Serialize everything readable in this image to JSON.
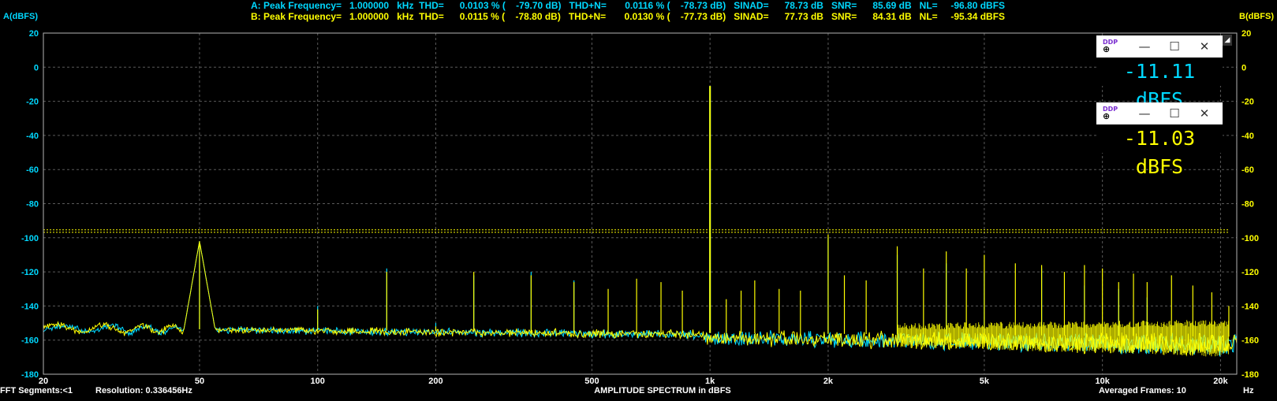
{
  "colors": {
    "channel_a": "#00d8ff",
    "channel_b": "#ffff00",
    "grid": "#5a5a5a",
    "frame": "#b4b4b4",
    "threshold": "#ffff00",
    "text": "#ffffff",
    "background": "#000000"
  },
  "measurements": {
    "a": "A: Peak Frequency=   1.000000   kHz  THD=      0.0103 % (    -79.70 dB)   THD+N=       0.0116 % (    -78.73 dB)   SINAD=      78.73 dB   SNR=      85.69 dB   NL=     -96.80 dBFS",
    "b": "B: Peak Frequency=   1.000000   kHz  THD=      0.0115 % (    -78.80 dB)   THD+N=       0.0130 % (    -77.73 dB)   SINAD=      77.73 dB   SNR=      84.31 dB   NL=     -95.34 dBFS"
  },
  "footer": {
    "fft_segments": "FFT Segments:<1",
    "resolution": "Resolution: 0.336456Hz",
    "title": "AMPLITUDE SPECTRUM in dBFS",
    "frames": "Averaged Frames: 10",
    "x_unit": "Hz"
  },
  "windows": {
    "icon_label": "DDP",
    "minimize": "—",
    "maximize": "☐",
    "close": "✕",
    "handle": "◢",
    "readout_a": "-11.11 dBFS",
    "readout_b": "-11.03 dBFS"
  },
  "chart_data": {
    "type": "line",
    "title": "AMPLITUDE SPECTRUM in dBFS",
    "ylabel_left": "A(dBFS)",
    "ylabel_right": "B(dBFS)",
    "xlabel": "Hz",
    "xscale": "log",
    "xlim": [
      20,
      22000
    ],
    "ylim": [
      -180,
      20
    ],
    "grid": true,
    "y_ticks": [
      20,
      0,
      -20,
      -40,
      -60,
      -80,
      -100,
      -120,
      -140,
      -160,
      -180
    ],
    "x_ticks": [
      {
        "value": 20,
        "label": "20"
      },
      {
        "value": 50,
        "label": "50"
      },
      {
        "value": 100,
        "label": "100"
      },
      {
        "value": 200,
        "label": "200"
      },
      {
        "value": 500,
        "label": "500"
      },
      {
        "value": 1000,
        "label": "1k"
      },
      {
        "value": 2000,
        "label": "2k"
      },
      {
        "value": 5000,
        "label": "5k"
      },
      {
        "value": 10000,
        "label": "10k"
      },
      {
        "value": 20000,
        "label": "20k"
      }
    ],
    "noise_level_lines": [
      -95.34,
      -96.8
    ],
    "noise_floor": {
      "start_db": -153,
      "end_db": -158
    },
    "series": [
      {
        "name": "A",
        "color": "#00d8ff",
        "peaks": [
          {
            "f": 50,
            "db": -102
          },
          {
            "f": 100,
            "db": -140
          },
          {
            "f": 150,
            "db": -118
          },
          {
            "f": 200,
            "db": -150
          },
          {
            "f": 250,
            "db": -122
          },
          {
            "f": 350,
            "db": -120
          },
          {
            "f": 450,
            "db": -125
          },
          {
            "f": 1000,
            "db": -11.11
          },
          {
            "f": 2000,
            "db": -100
          },
          {
            "f": 3000,
            "db": -110
          },
          {
            "f": 4000,
            "db": -115
          },
          {
            "f": 5000,
            "db": -120
          },
          {
            "f": 7000,
            "db": -118
          },
          {
            "f": 9000,
            "db": -128
          },
          {
            "f": 11000,
            "db": -130
          },
          {
            "f": 13000,
            "db": -135
          }
        ]
      },
      {
        "name": "B",
        "color": "#ffff00",
        "peaks": [
          {
            "f": 50,
            "db": -102
          },
          {
            "f": 100,
            "db": -142
          },
          {
            "f": 150,
            "db": -120
          },
          {
            "f": 200,
            "db": -152
          },
          {
            "f": 250,
            "db": -120
          },
          {
            "f": 350,
            "db": -122
          },
          {
            "f": 450,
            "db": -126
          },
          {
            "f": 550,
            "db": -130
          },
          {
            "f": 650,
            "db": -124
          },
          {
            "f": 750,
            "db": -126
          },
          {
            "f": 850,
            "db": -131
          },
          {
            "f": 1000,
            "db": -11.03
          },
          {
            "f": 1100,
            "db": -136
          },
          {
            "f": 1200,
            "db": -131
          },
          {
            "f": 1300,
            "db": -125
          },
          {
            "f": 1500,
            "db": -130
          },
          {
            "f": 1700,
            "db": -131
          },
          {
            "f": 2000,
            "db": -98
          },
          {
            "f": 2200,
            "db": -122
          },
          {
            "f": 2500,
            "db": -125
          },
          {
            "f": 3000,
            "db": -105
          },
          {
            "f": 3500,
            "db": -118
          },
          {
            "f": 4000,
            "db": -108
          },
          {
            "f": 4500,
            "db": -118
          },
          {
            "f": 5000,
            "db": -110
          },
          {
            "f": 6000,
            "db": -115
          },
          {
            "f": 7000,
            "db": -116
          },
          {
            "f": 8000,
            "db": -120
          },
          {
            "f": 9000,
            "db": -116
          },
          {
            "f": 10000,
            "db": -118
          },
          {
            "f": 11000,
            "db": -126
          },
          {
            "f": 12000,
            "db": -121
          },
          {
            "f": 13000,
            "db": -126
          },
          {
            "f": 15000,
            "db": -122
          },
          {
            "f": 17000,
            "db": -128
          },
          {
            "f": 19000,
            "db": -132
          },
          {
            "f": 21000,
            "db": -140
          }
        ]
      }
    ]
  }
}
